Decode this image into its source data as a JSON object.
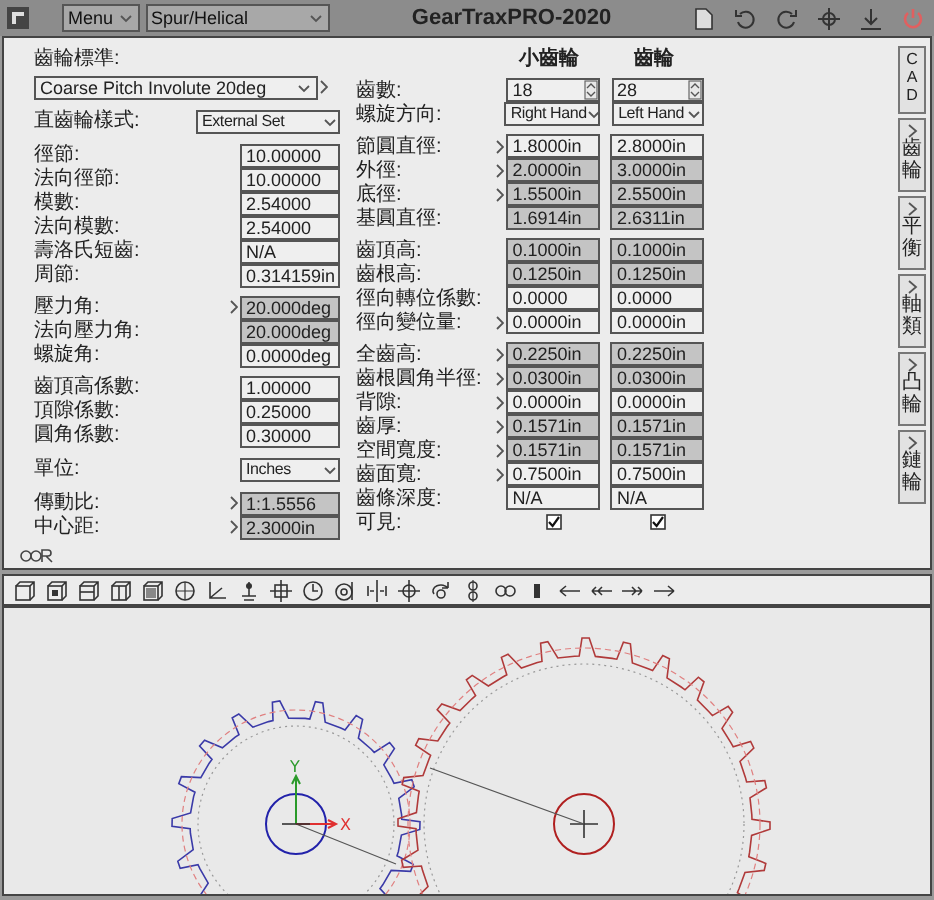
{
  "title_bar": {
    "menu": "Menu",
    "mode": "Spur/Helical",
    "title": "GearTraxPRO-2020"
  },
  "left": {
    "standard_label": "齒輪標準:",
    "standard": "Coarse Pitch Involute 20deg",
    "groups": [
      [
        {
          "kind": "select",
          "label": "直齒輪樣式:",
          "value": "External Set"
        }
      ],
      [
        {
          "kind": "field",
          "label": "徑節:",
          "value": "10.00000",
          "shaded": false,
          "arrow": false
        },
        {
          "kind": "field",
          "label": "法向徑節:",
          "value": "10.00000",
          "shaded": false,
          "arrow": false
        },
        {
          "kind": "field",
          "label": "模數:",
          "value": "2.54000",
          "shaded": false,
          "arrow": false
        },
        {
          "kind": "field",
          "label": "法向模數:",
          "value": "2.54000",
          "shaded": false,
          "arrow": false
        },
        {
          "kind": "field",
          "label": "壽洛氏短齒:",
          "value": "N/A",
          "shaded": false,
          "arrow": false
        },
        {
          "kind": "field",
          "label": "周節:",
          "value": "0.314159in",
          "shaded": false,
          "arrow": false
        }
      ],
      [
        {
          "kind": "field",
          "label": "壓力角:",
          "value": "20.000deg",
          "shaded": true,
          "arrow": true
        },
        {
          "kind": "field",
          "label": "法向壓力角:",
          "value": "20.000deg",
          "shaded": true,
          "arrow": false
        },
        {
          "kind": "field",
          "label": "螺旋角:",
          "value": "0.0000deg",
          "shaded": false,
          "arrow": false
        }
      ],
      [
        {
          "kind": "field",
          "label": "齒頂高係數:",
          "value": "1.00000",
          "shaded": false,
          "arrow": false
        },
        {
          "kind": "field",
          "label": "頂隙係數:",
          "value": "0.25000",
          "shaded": false,
          "arrow": false
        },
        {
          "kind": "field",
          "label": "圓角係數:",
          "value": "0.30000",
          "shaded": false,
          "arrow": false
        }
      ],
      [
        {
          "kind": "select",
          "label": "單位:",
          "value": "Inches"
        }
      ],
      [
        {
          "kind": "field",
          "label": "傳動比:",
          "value": "1:1.5556",
          "shaded": true,
          "arrow": true
        },
        {
          "kind": "field",
          "label": "中心距:",
          "value": "2.3000in",
          "shaded": true,
          "arrow": true
        }
      ]
    ]
  },
  "middle": {
    "headers": [
      "小齒輪",
      "齒輪"
    ],
    "groups": [
      [
        {
          "label": "齒數:",
          "cells": [
            {
              "kind": "spin",
              "value": "18"
            },
            {
              "kind": "spin",
              "value": "28"
            }
          ]
        },
        {
          "label": "螺旋方向:",
          "cells": [
            {
              "kind": "select",
              "value": "Right Hand"
            },
            {
              "kind": "select",
              "value": "Left Hand"
            }
          ]
        }
      ],
      [
        {
          "label": "節圓直徑:",
          "cells": [
            {
              "kind": "field",
              "value": "1.8000in",
              "shaded": false,
              "arrow": true
            },
            {
              "kind": "field",
              "value": "2.8000in",
              "shaded": false,
              "arrow": false
            }
          ]
        },
        {
          "label": "外徑:",
          "cells": [
            {
              "kind": "field",
              "value": "2.0000in",
              "shaded": true,
              "arrow": true
            },
            {
              "kind": "field",
              "value": "3.0000in",
              "shaded": true,
              "arrow": false
            }
          ]
        },
        {
          "label": "底徑:",
          "cells": [
            {
              "kind": "field",
              "value": "1.5500in",
              "shaded": true,
              "arrow": true
            },
            {
              "kind": "field",
              "value": "2.5500in",
              "shaded": true,
              "arrow": false
            }
          ]
        },
        {
          "label": "基圓直徑:",
          "cells": [
            {
              "kind": "field",
              "value": "1.6914in",
              "shaded": true,
              "arrow": false
            },
            {
              "kind": "field",
              "value": "2.6311in",
              "shaded": true,
              "arrow": false
            }
          ]
        }
      ],
      [
        {
          "label": "齒頂高:",
          "cells": [
            {
              "kind": "field",
              "value": "0.1000in",
              "shaded": true,
              "arrow": false
            },
            {
              "kind": "field",
              "value": "0.1000in",
              "shaded": true,
              "arrow": false
            }
          ]
        },
        {
          "label": "齒根高:",
          "cells": [
            {
              "kind": "field",
              "value": "0.1250in",
              "shaded": true,
              "arrow": false
            },
            {
              "kind": "field",
              "value": "0.1250in",
              "shaded": true,
              "arrow": false
            }
          ]
        },
        {
          "label": "徑向轉位係數:",
          "cells": [
            {
              "kind": "field",
              "value": "0.0000",
              "shaded": false,
              "arrow": false
            },
            {
              "kind": "field",
              "value": "0.0000",
              "shaded": false,
              "arrow": false
            }
          ]
        },
        {
          "label": "徑向變位量:",
          "cells": [
            {
              "kind": "field",
              "value": "0.0000in",
              "shaded": false,
              "arrow": true
            },
            {
              "kind": "field",
              "value": "0.0000in",
              "shaded": false,
              "arrow": false
            }
          ]
        }
      ],
      [
        {
          "label": "全齒高:",
          "cells": [
            {
              "kind": "field",
              "value": "0.2250in",
              "shaded": true,
              "arrow": true
            },
            {
              "kind": "field",
              "value": "0.2250in",
              "shaded": true,
              "arrow": false
            }
          ]
        },
        {
          "label": "齒根圓角半徑:",
          "cells": [
            {
              "kind": "field",
              "value": "0.0300in",
              "shaded": true,
              "arrow": true
            },
            {
              "kind": "field",
              "value": "0.0300in",
              "shaded": true,
              "arrow": false
            }
          ]
        },
        {
          "label": "背隙:",
          "cells": [
            {
              "kind": "field",
              "value": "0.0000in",
              "shaded": false,
              "arrow": true
            },
            {
              "kind": "field",
              "value": "0.0000in",
              "shaded": false,
              "arrow": false
            }
          ]
        },
        {
          "label": "齒厚:",
          "cells": [
            {
              "kind": "field",
              "value": "0.1571in",
              "shaded": true,
              "arrow": true
            },
            {
              "kind": "field",
              "value": "0.1571in",
              "shaded": true,
              "arrow": false
            }
          ]
        },
        {
          "label": "空間寬度:",
          "cells": [
            {
              "kind": "field",
              "value": "0.1571in",
              "shaded": true,
              "arrow": true
            },
            {
              "kind": "field",
              "value": "0.1571in",
              "shaded": true,
              "arrow": false
            }
          ]
        },
        {
          "label": "齒面寬:",
          "cells": [
            {
              "kind": "field",
              "value": "0.7500in",
              "shaded": false,
              "arrow": true
            },
            {
              "kind": "field",
              "value": "0.7500in",
              "shaded": false,
              "arrow": false
            }
          ]
        },
        {
          "label": "齒條深度:",
          "cells": [
            {
              "kind": "field",
              "value": "N/A",
              "shaded": false,
              "arrow": false
            },
            {
              "kind": "field",
              "value": "N/A",
              "shaded": false,
              "arrow": false
            }
          ]
        },
        {
          "label": "可見:",
          "cells": [
            {
              "kind": "check",
              "checked": true
            },
            {
              "kind": "check",
              "checked": true
            }
          ]
        }
      ]
    ]
  },
  "side_tabs": [
    "CAD",
    "齒輪",
    "平衡",
    "軸類",
    "凸輪",
    "鏈輪"
  ],
  "canvas": {
    "axis_x": "X",
    "axis_y": "Y"
  }
}
